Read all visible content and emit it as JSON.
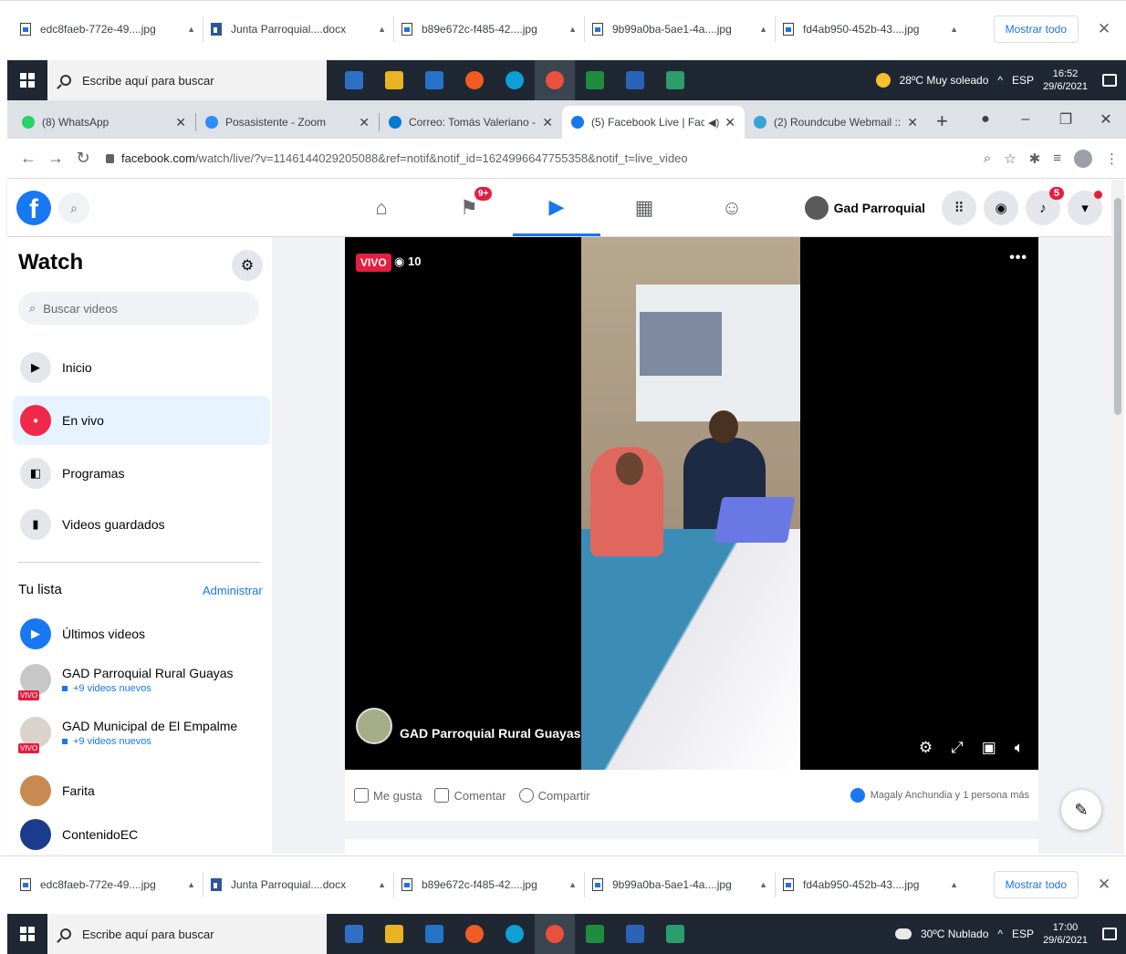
{
  "downloads": {
    "files": [
      {
        "name": "edc8faeb-772e-49....jpg",
        "type": "jpg"
      },
      {
        "name": "Junta Parroquial....docx",
        "type": "docx"
      },
      {
        "name": "b89e672c-f485-42....jpg",
        "type": "jpg"
      },
      {
        "name": "9b99a0ba-5ae1-4a....jpg",
        "type": "jpg"
      },
      {
        "name": "fd4ab950-452b-43....jpg",
        "type": "jpg"
      }
    ],
    "show_all": "Mostrar todo",
    "close": "✕"
  },
  "taskbar_top": {
    "search_placeholder": "Escribe aquí para buscar",
    "weather": "28ºC  Muy soleado",
    "lang": "ESP",
    "time": "16:52",
    "date": "29/6/2021"
  },
  "taskbar_bottom": {
    "search_placeholder": "Escribe aquí para buscar",
    "weather": "30ºC  Nublado",
    "lang": "ESP",
    "time": "17:00",
    "date": "29/6/2021"
  },
  "taskbar_apps": [
    "#2f6fc6",
    "#e8b423",
    "#2572c9",
    "#f25c22",
    "#0f9fd8",
    "#e9513d",
    "#1e8e3e",
    "#2b63b9",
    "#2a9d6b"
  ],
  "browser": {
    "tabs": [
      {
        "title": "(8) WhatsApp",
        "color": "#25d366"
      },
      {
        "title": "Posasistente - Zoom",
        "color": "#2d8cff"
      },
      {
        "title": "Correo: Tomás Valeriano - O...",
        "color": "#0078d4"
      },
      {
        "title": "(5) Facebook Live | Face...",
        "color": "#1877f2"
      },
      {
        "title": "(2) Roundcube Webmail :: En...",
        "color": "#37a3d4"
      }
    ],
    "new_tab": "+",
    "url_host": "facebook.com",
    "url_path": "/watch/live/?v=1146144029205088&ref=notif&notif_id=1624996647755358&notif_t=live_video"
  },
  "fb": {
    "nav_badge": "9+",
    "user_name": "Gad Parroquial",
    "notif_count": "5"
  },
  "sidebar": {
    "title": "Watch",
    "search_placeholder": "Buscar videos",
    "menu": [
      {
        "label": "Inicio",
        "icon": "play-square-icon"
      },
      {
        "label": "En vivo",
        "icon": "live-icon"
      },
      {
        "label": "Programas",
        "icon": "clapper-icon"
      },
      {
        "label": "Videos guardados",
        "icon": "bookmark-icon"
      }
    ],
    "list_header": "Tu lista",
    "manage": "Administrar",
    "latest": "Últimos videos",
    "pages": [
      {
        "name": "GAD Parroquial Rural Guayas",
        "sub": "+9 videos nuevos",
        "live": "VIVO"
      },
      {
        "name": "GAD Municipal de El Empalme",
        "sub": "+9 videos nuevos",
        "live": "VIVO"
      },
      {
        "name": "Farita",
        "sub": "",
        "live": ""
      },
      {
        "name": "ContenidoEC",
        "sub": "",
        "live": ""
      }
    ]
  },
  "video": {
    "live_label": "VIVO",
    "viewers": "10",
    "page_name": "GAD Parroquial Rural Guayas"
  },
  "actions": {
    "like": "Me gusta",
    "comment": "Comentar",
    "share": "Compartir",
    "reactions": "Magaly Anchundia y 1 persona más"
  }
}
